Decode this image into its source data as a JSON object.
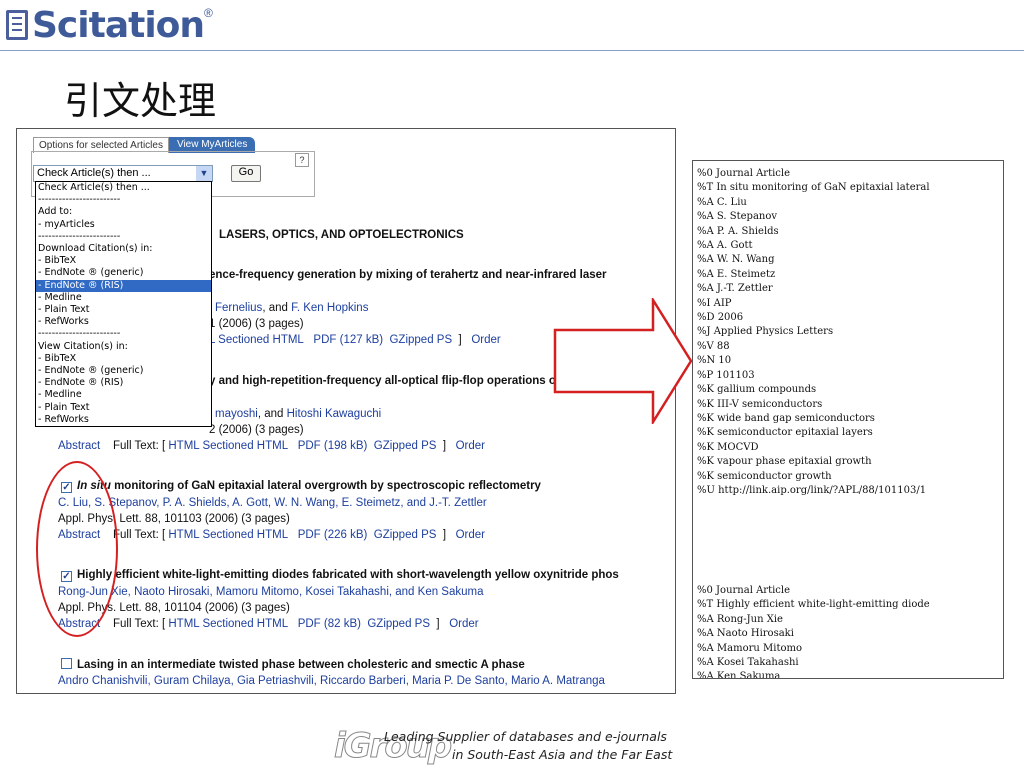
{
  "header": {
    "brand": "Scitation",
    "reg": "®",
    "title": "引文处理"
  },
  "options": {
    "tab_selected": "Options for selected Articles",
    "tab_view": "View MyArticles",
    "help": "?",
    "select_value": "Check Article(s) then ...",
    "go_label": "Go",
    "dropdown": [
      "Check Article(s) then ...",
      "------------------------",
      "Add to:",
      "- myArticles",
      "------------------------",
      "Download Citation(s) in:",
      "- BibTeX",
      "- EndNote ® (generic)",
      "- EndNote ® (RIS)",
      "- Medline",
      "- Plain Text",
      "- RefWorks",
      "------------------------",
      "View Citation(s) in:",
      "- BibTeX",
      "- EndNote ® (generic)",
      "- EndNote ® (RIS)",
      "- Medline",
      "- Plain Text",
      "- RefWorks"
    ],
    "dropdown_highlight_index": 8
  },
  "section_heading": "LASERS, OPTICS, AND OPTOELECTRONICS",
  "articles": [
    {
      "title": "ence-frequency generation by mixing of terahertz and near-infrared laser",
      "authors": [
        "Fernelius",
        ", and ",
        "F. Ken Hopkins"
      ],
      "ref": "1 (2006) (3 pages)",
      "fulltext": [
        "L Sectioned HTML",
        "PDF (127 kB)",
        "GZipped PS",
        "]",
        "Order"
      ]
    },
    {
      "title": "y and high-repetition-frequency all-optical flip-flop operations of a polarization",
      "authors": [
        "mayoshi",
        ", and ",
        "Hitoshi Kawaguchi"
      ],
      "ref": "2 (2006) (3 pages)",
      "fulltext": [
        "Abstract",
        "Full Text: [",
        "HTML Sectioned HTML",
        "PDF (198 kB)",
        "GZipped PS",
        "]",
        "Order"
      ]
    },
    {
      "checked": true,
      "title_italic": "In situ",
      "title": " monitoring of GaN epitaxial lateral overgrowth by spectroscopic reflectometry",
      "authors": "C. Liu, S. Stepanov, P. A. Shields, A. Gott, W. N. Wang, E. Steimetz, and J.-T. Zettler",
      "ref": "Appl. Phys. Lett. 88, 101103 (2006) (3 pages)",
      "fulltext": [
        "Abstract",
        "Full Text: [",
        "HTML Sectioned HTML",
        "PDF (226 kB)",
        "GZipped PS",
        "]",
        "Order"
      ]
    },
    {
      "checked": true,
      "title": "Highly efficient white-light-emitting diodes fabricated with short-wavelength yellow oxynitride phos",
      "authors": "Rong-Jun Xie, Naoto Hirosaki, Mamoru Mitomo, Kosei Takahashi, and Ken Sakuma",
      "ref": "Appl. Phys. Lett. 88, 101104 (2006) (3 pages)",
      "fulltext": [
        "Abstract",
        "Full Text: [",
        "HTML Sectioned HTML",
        "PDF (82 kB)",
        "GZipped PS",
        "]",
        "Order"
      ]
    },
    {
      "checked": false,
      "title": "Lasing in an intermediate twisted phase between cholesteric and smectic A phase",
      "authors": "Andro Chanishvili, Guram Chilaya, Gia Petriashvili, Riccardo Barberi, Maria P. De Santo, Mario A. Matranga"
    }
  ],
  "ris_record_1": [
    "%0 Journal Article",
    "%T In situ monitoring of GaN epitaxial lateral",
    "%A C. Liu",
    "%A S. Stepanov",
    "%A P. A. Shields",
    "%A A. Gott",
    "%A W. N. Wang",
    "%A E. Steimetz",
    "%A J.-T. Zettler",
    "%I AIP",
    "%D 2006",
    "%J Applied Physics Letters",
    "%V 88",
    "%N 10",
    "%P 101103",
    "%K gallium compounds",
    "%K III-V semiconductors",
    "%K wide band gap semiconductors",
    "%K semiconductor epitaxial layers",
    "%K MOCVD",
    "%K vapour phase epitaxial growth",
    "%K semiconductor growth",
    "%U http://link.aip.org/link/?APL/88/101103/1"
  ],
  "ris_record_2": [
    "%0 Journal Article",
    "%T Highly efficient white-light-emitting diode",
    "%A Rong-Jun Xie",
    "%A Naoto Hirosaki",
    "%A Mamoru Mitomo",
    "%A Kosei Takahashi",
    "%A Ken Sakuma"
  ],
  "footer": {
    "logo": "iGroup",
    "line1": "Leading Supplier of databases and e-journals",
    "line2": "in South-East Asia and the Far East"
  },
  "colors": {
    "brand": "#3e5a98",
    "link": "#1d3f9e",
    "annotation": "#d42020"
  }
}
